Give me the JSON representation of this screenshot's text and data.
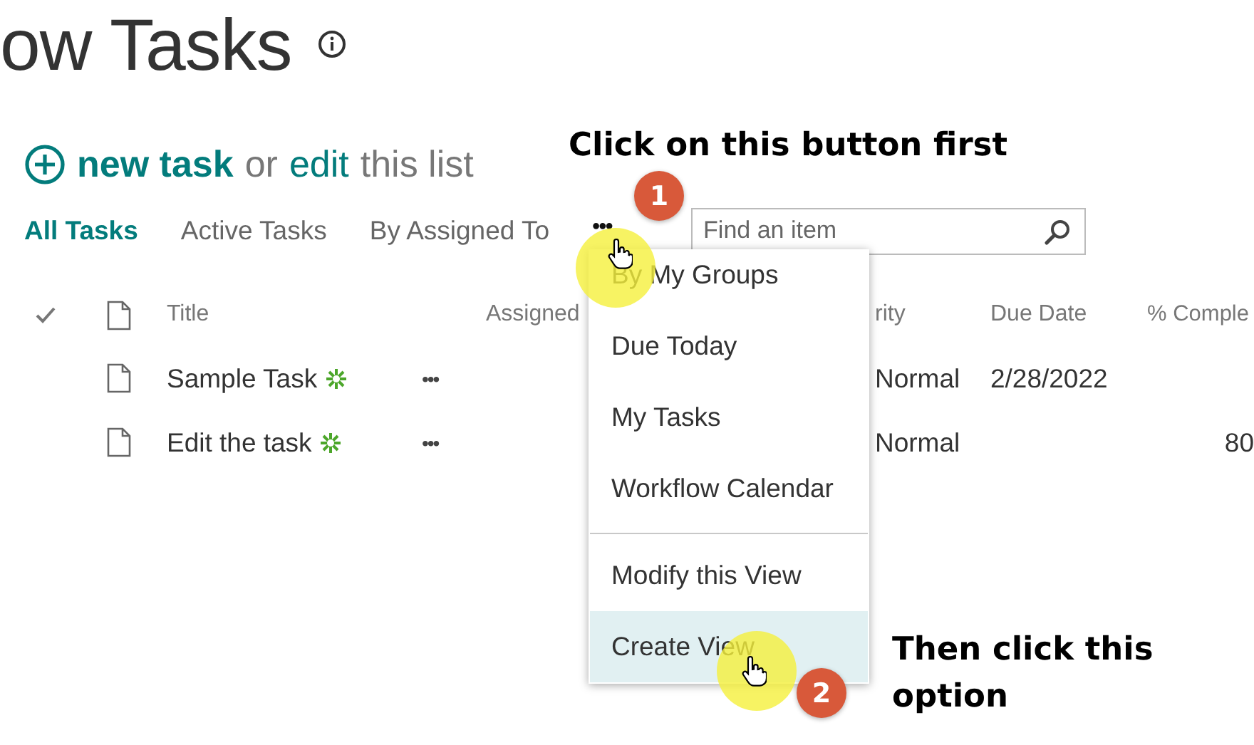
{
  "page_title": "ow Tasks",
  "list_actions": {
    "new_task": "new task",
    "or": "or",
    "edit": "edit",
    "this_list": "this list"
  },
  "views": [
    {
      "label": "All Tasks",
      "selected": true
    },
    {
      "label": "Active Tasks",
      "selected": false
    },
    {
      "label": "By Assigned To",
      "selected": false
    }
  ],
  "more_views": "•••",
  "search": {
    "placeholder": "Find an item"
  },
  "table": {
    "columns": [
      "Title",
      "Assigned",
      "rity",
      "Due Date",
      "% Comple"
    ],
    "rows": [
      {
        "title": "Sample Task",
        "new": true,
        "more": "•••",
        "priority": "Normal",
        "due_date": "2/28/2022"
      },
      {
        "title": "Edit the task",
        "new": true,
        "more": "•••",
        "priority": "Normal",
        "complete": "80"
      }
    ]
  },
  "menu": {
    "groups": [
      [
        {
          "label": "By My Groups",
          "selected": false
        },
        {
          "label": "Due Today",
          "selected": false
        },
        {
          "label": "My Tasks",
          "selected": false
        },
        {
          "label": "Workflow Calendar",
          "selected": false
        }
      ],
      [
        {
          "label": "Modify this View",
          "selected": false
        },
        {
          "label": "Create View",
          "selected": true
        }
      ]
    ]
  },
  "callouts": [
    {
      "number": "1",
      "text": "Click on this button first"
    },
    {
      "number": "2",
      "text": "Then click this option"
    }
  ]
}
